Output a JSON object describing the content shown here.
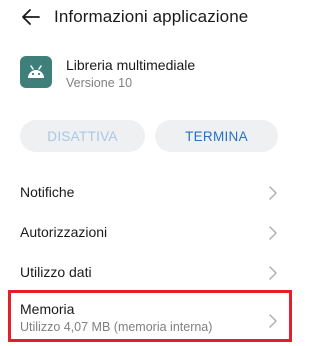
{
  "header": {
    "title": "Informazioni applicazione",
    "back_icon": "back-arrow-icon"
  },
  "app": {
    "name": "Libreria multimediale",
    "version": "Versione 10",
    "icon": "android-icon",
    "icon_color": "#3f7f7a"
  },
  "actions": {
    "disable_label": "DISATTIVA",
    "disable_enabled": false,
    "stop_label": "TERMINA",
    "stop_enabled": true,
    "accent_color": "#2a70c8"
  },
  "settings": {
    "items": [
      {
        "label": "Notifiche"
      },
      {
        "label": "Autorizzazioni"
      },
      {
        "label": "Utilizzo dati"
      }
    ],
    "memory": {
      "label": "Memoria",
      "detail": "Utilizzo 4,07 MB (memoria interna)",
      "highlighted": true,
      "highlight_color": "#e41e2b"
    }
  }
}
